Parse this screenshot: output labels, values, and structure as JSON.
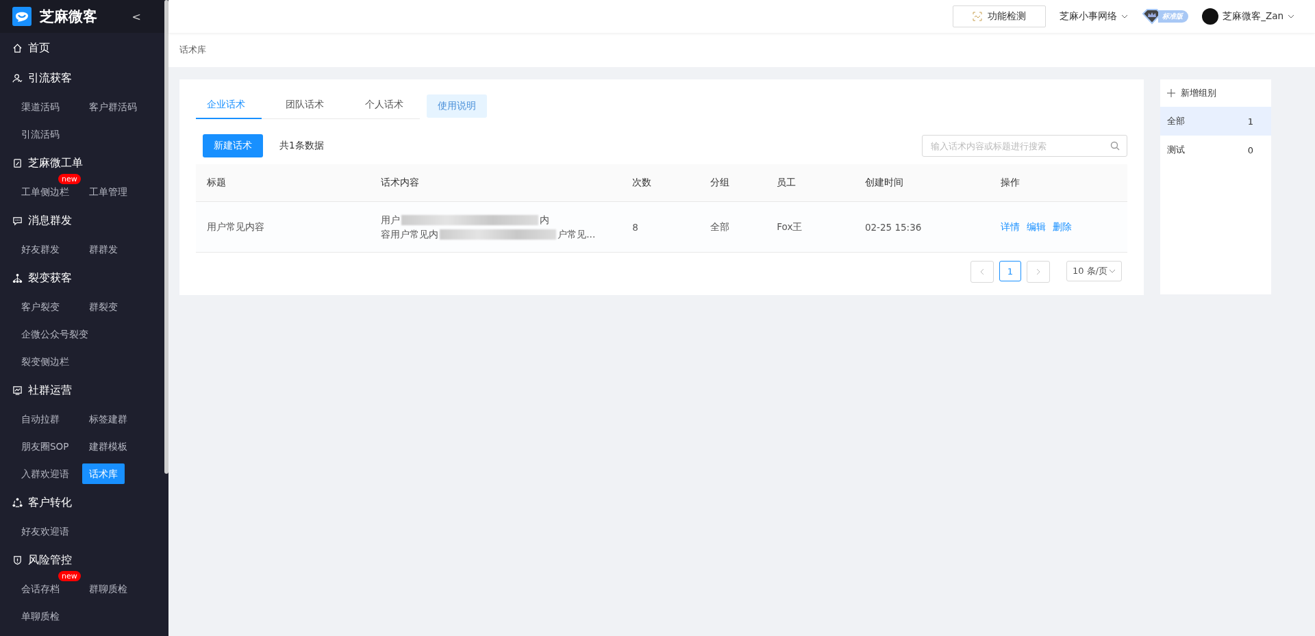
{
  "brand": {
    "name": "芝麻微客",
    "collapse": "<"
  },
  "sidebar": {
    "groups": [
      {
        "label": "首页"
      },
      {
        "label": "引流获客",
        "items": [
          {
            "label": "渠道活码",
            "selected": false
          },
          {
            "label": "客户群活码",
            "selected": false
          },
          {
            "label": "引流活码",
            "selected": false
          }
        ]
      },
      {
        "label": "芝麻微工单",
        "items": [
          {
            "label": "工单侧边栏",
            "selected": false,
            "badge": "new"
          },
          {
            "label": "工单管理",
            "selected": false
          }
        ]
      },
      {
        "label": "消息群发",
        "items": [
          {
            "label": "好友群发",
            "selected": false
          },
          {
            "label": "群群发",
            "selected": false
          }
        ]
      },
      {
        "label": "裂变获客",
        "items": [
          {
            "label": "客户裂变",
            "selected": false
          },
          {
            "label": "群裂变",
            "selected": false
          },
          {
            "label": "企微公众号裂变",
            "selected": false
          },
          {
            "label": "裂变侧边栏",
            "selected": false
          }
        ]
      },
      {
        "label": "社群运营",
        "items": [
          {
            "label": "自动拉群",
            "selected": false
          },
          {
            "label": "标签建群",
            "selected": false
          },
          {
            "label": "朋友圈SOP",
            "selected": false
          },
          {
            "label": "建群模板",
            "selected": false
          },
          {
            "label": "入群欢迎语",
            "selected": false
          },
          {
            "label": "话术库",
            "selected": true
          }
        ]
      },
      {
        "label": "客户转化",
        "items": [
          {
            "label": "好友欢迎语",
            "selected": false
          }
        ]
      },
      {
        "label": "风险管控",
        "items": [
          {
            "label": "会话存档",
            "selected": false,
            "badge": "new"
          },
          {
            "label": "群聊质检",
            "selected": false
          },
          {
            "label": "单聊质检",
            "selected": false
          }
        ]
      }
    ]
  },
  "topbar": {
    "check_button": "功能检测",
    "org": "芝麻小事网络",
    "edition": "标准版",
    "user": "芝麻微客_Zan"
  },
  "breadcrumb": "话术库",
  "tabs": [
    {
      "label": "企业话术",
      "selected": true
    },
    {
      "label": "团队话术",
      "selected": false
    },
    {
      "label": "个人话术",
      "selected": false
    }
  ],
  "help_button": "使用说明",
  "new_button": "新建话术",
  "total": "共1条数据",
  "search": {
    "placeholder": "输入话术内容或标题进行搜索"
  },
  "table": {
    "columns": [
      "标题",
      "话术内容",
      "次数",
      "分组",
      "员工",
      "创建时间",
      "操作"
    ],
    "rows": [
      {
        "title": "用户常见内容",
        "content_lines": [
          {
            "start": "用户",
            "end": "内"
          },
          {
            "start": "容用户常见内",
            "end": "户常见..."
          }
        ],
        "count": "8",
        "group": "全部",
        "staff": "Fox王",
        "created": "02-25 15:36",
        "actions": [
          "详情",
          "编辑",
          "删除"
        ]
      }
    ]
  },
  "pagination": {
    "pages": [
      {
        "label": "1",
        "selected": true
      }
    ],
    "page_size": "10 条/页"
  },
  "groups_panel": {
    "add": "新增组别",
    "groups": [
      {
        "name": "全部",
        "count": "1",
        "selected": true
      },
      {
        "name": "测试",
        "count": "0",
        "selected": false
      }
    ]
  }
}
